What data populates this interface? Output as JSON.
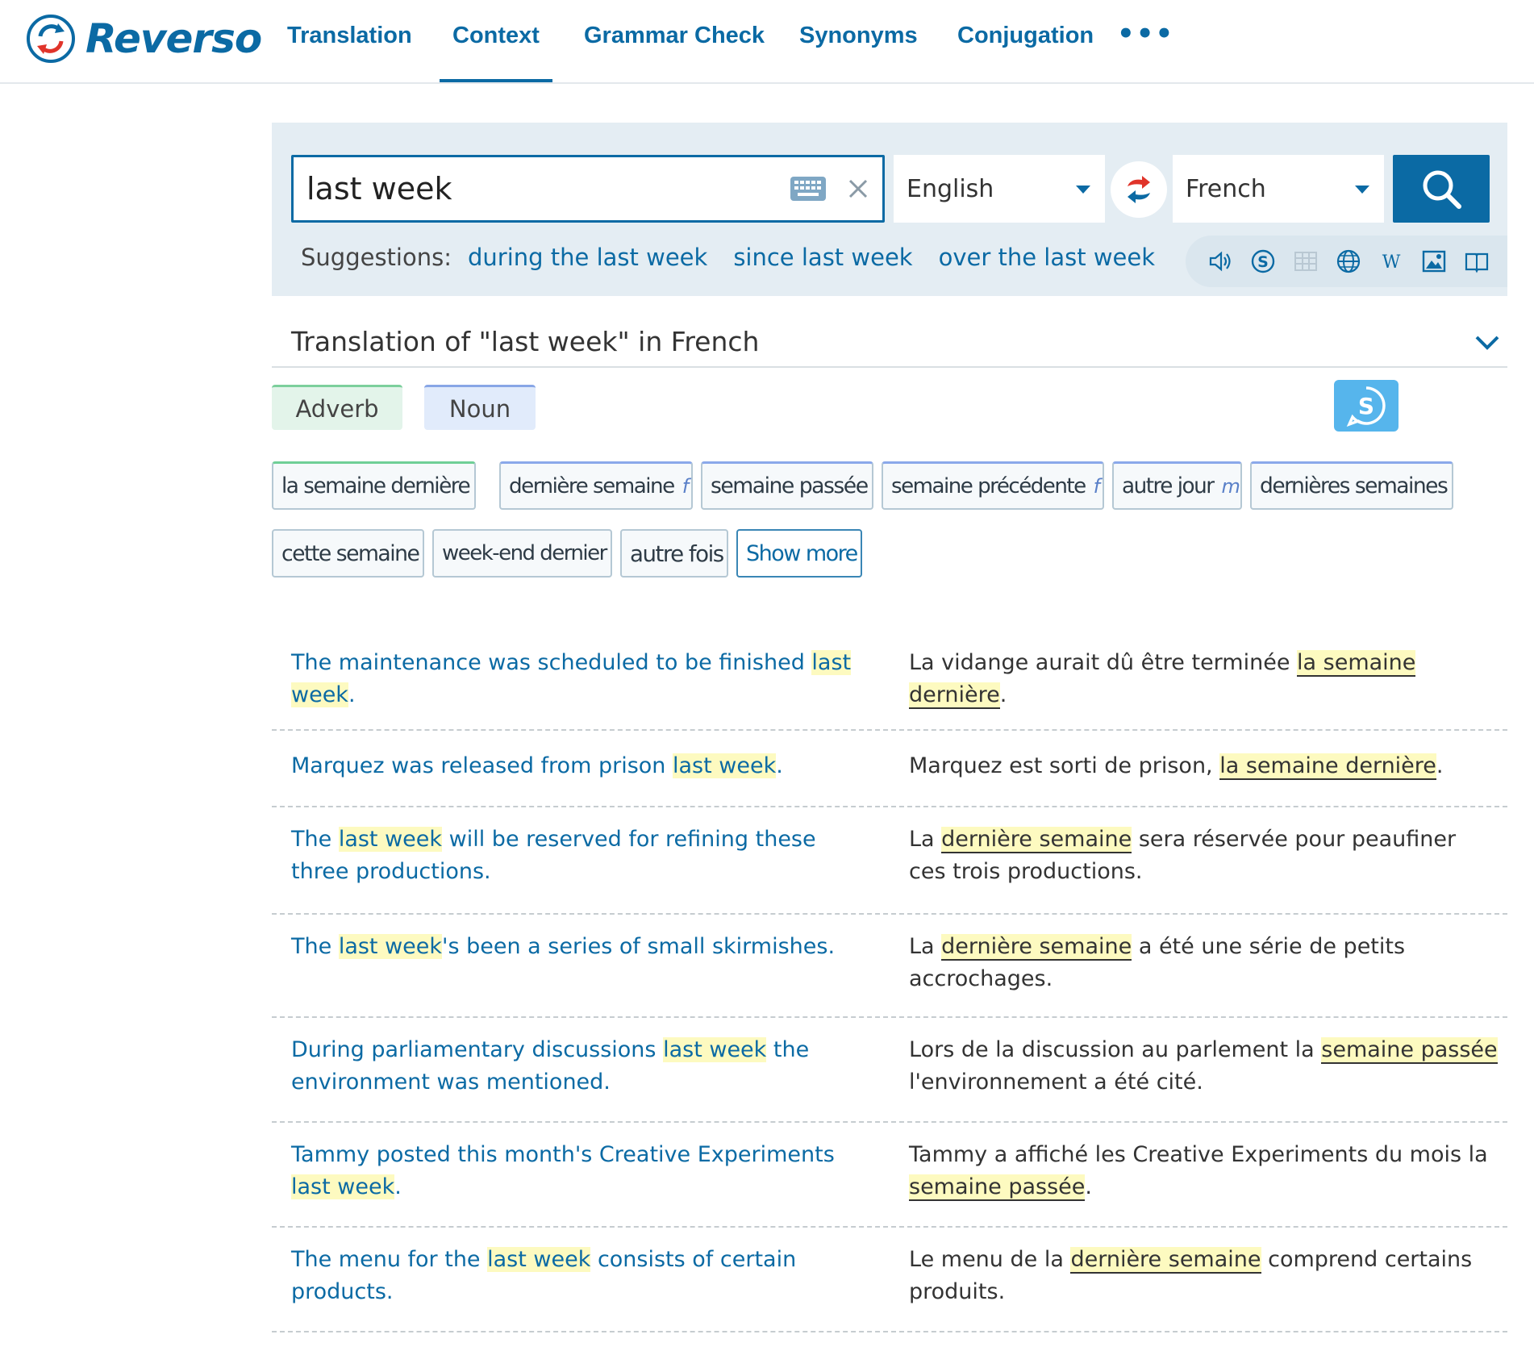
{
  "brand": {
    "name": "Reverso"
  },
  "nav": {
    "items": [
      "Translation",
      "Context",
      "Grammar Check",
      "Synonyms",
      "Conjugation"
    ],
    "more": "•••"
  },
  "search": {
    "query": "last week",
    "source_lang": "English",
    "target_lang": "French"
  },
  "suggestions": {
    "label": "Suggestions:",
    "items": [
      "during the last week",
      "since last week",
      "over the last week"
    ]
  },
  "translation": {
    "title": "Translation of \"last week\" in French",
    "pos_tabs": [
      "Adverb",
      "Noun"
    ],
    "chips": [
      {
        "text": "la semaine dernière",
        "gender": "",
        "kind": "adv"
      },
      {
        "text": "dernière semaine",
        "gender": "f",
        "kind": "noun"
      },
      {
        "text": "semaine passée",
        "gender": "",
        "kind": "noun"
      },
      {
        "text": "semaine précédente",
        "gender": "f",
        "kind": "noun"
      },
      {
        "text": "autre jour",
        "gender": "m",
        "kind": "noun"
      },
      {
        "text": "dernières semaines",
        "gender": "",
        "kind": "noun"
      },
      {
        "text": "cette semaine",
        "gender": "",
        "kind": ""
      },
      {
        "text": "week-end dernier",
        "gender": "",
        "kind": ""
      },
      {
        "text": "autre fois",
        "gender": "",
        "kind": ""
      }
    ],
    "show_more": "Show more"
  },
  "examples": [
    {
      "src": [
        [
          "The maintenance was scheduled to be finished ",
          false
        ],
        [
          "last week",
          true
        ],
        [
          ".",
          false
        ]
      ],
      "tgt": [
        [
          "La vidange aurait dû être terminée ",
          false
        ],
        [
          "la semaine dernière",
          true
        ],
        [
          ".",
          false
        ]
      ]
    },
    {
      "src": [
        [
          "Marquez was released from prison ",
          false
        ],
        [
          "last week",
          true
        ],
        [
          ".",
          false
        ]
      ],
      "tgt": [
        [
          "Marquez est sorti de prison, ",
          false
        ],
        [
          "la semaine dernière",
          true
        ],
        [
          ".",
          false
        ]
      ]
    },
    {
      "src": [
        [
          "The ",
          false
        ],
        [
          "last week",
          true
        ],
        [
          " will be reserved for refining these three productions.",
          false
        ]
      ],
      "tgt": [
        [
          "La ",
          false
        ],
        [
          "dernière semaine",
          true
        ],
        [
          " sera réservée pour peaufiner ces trois productions.",
          false
        ]
      ]
    },
    {
      "src": [
        [
          "The ",
          false
        ],
        [
          "last week",
          true
        ],
        [
          "'s been a series of small skirmishes.",
          false
        ]
      ],
      "tgt": [
        [
          "La ",
          false
        ],
        [
          "dernière semaine",
          true
        ],
        [
          " a été une série de petits accrochages.",
          false
        ]
      ]
    },
    {
      "src": [
        [
          "During parliamentary discussions ",
          false
        ],
        [
          "last week",
          true
        ],
        [
          " the environment was mentioned.",
          false
        ]
      ],
      "tgt": [
        [
          "Lors de la discussion au parlement la ",
          false
        ],
        [
          "semaine passée",
          true
        ],
        [
          " l'environnement a été cité.",
          false
        ]
      ]
    },
    {
      "src": [
        [
          "Tammy posted this month's Creative Experiments ",
          false
        ],
        [
          "last week",
          true
        ],
        [
          ".",
          false
        ]
      ],
      "tgt": [
        [
          "Tammy a affiché les Creative Experiments du mois la ",
          false
        ],
        [
          "semaine passée",
          true
        ],
        [
          ".",
          false
        ]
      ]
    },
    {
      "src": [
        [
          "The menu for the ",
          false
        ],
        [
          "last week",
          true
        ],
        [
          " consists of certain products.",
          false
        ]
      ],
      "tgt": [
        [
          "Le menu de la ",
          false
        ],
        [
          "dernière semaine",
          true
        ],
        [
          " comprend certains produits.",
          false
        ]
      ]
    }
  ],
  "colors": {
    "brand_blue": "#0b6aa4",
    "highlight": "#fdfac0",
    "panel": "#e4edf3"
  },
  "icons": [
    "reverso-logo-icon",
    "keyboard-icon",
    "clear-icon",
    "swap-languages-icon",
    "search-icon",
    "speaker-icon",
    "synonyms-icon",
    "table-icon",
    "globe-icon",
    "wikipedia-icon",
    "image-icon",
    "dictionary-book-icon",
    "chevron-down-icon",
    "context-s-icon"
  ]
}
